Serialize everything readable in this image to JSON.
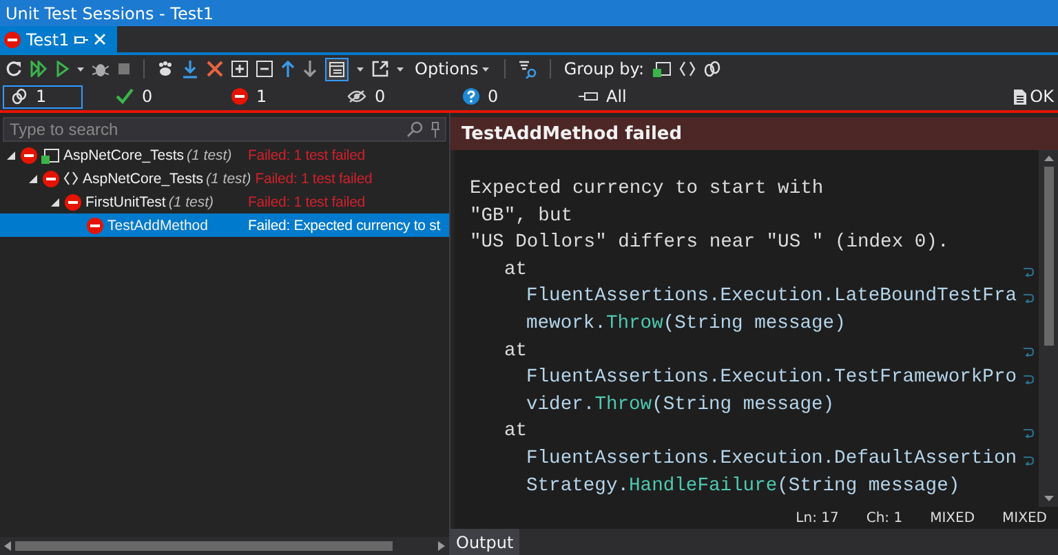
{
  "window": {
    "title": "Unit Test Sessions - Test1"
  },
  "tabs": [
    {
      "label": "Test1",
      "selected": true
    }
  ],
  "toolbar": {
    "options_label": "Options",
    "group_by_label": "Group by:"
  },
  "filters": [
    {
      "kind": "session",
      "count": "1",
      "selected": true
    },
    {
      "kind": "passed",
      "count": "0",
      "selected": false
    },
    {
      "kind": "failed",
      "count": "1",
      "selected": false
    },
    {
      "kind": "ignored",
      "count": "0",
      "selected": false
    },
    {
      "kind": "unknown",
      "count": "0",
      "selected": false
    },
    {
      "kind": "all",
      "label": "All",
      "selected": false
    }
  ],
  "result_badge": "OK",
  "search": {
    "placeholder": "Type to search"
  },
  "tree": [
    {
      "kind": "project",
      "name": "AspNetCore_Tests",
      "count": "(1 test)",
      "status": "Failed: 1 test failed",
      "expanded": true,
      "selected": false,
      "children": [
        {
          "kind": "namespace",
          "name": "AspNetCore_Tests",
          "count": "(1 test)",
          "status": "Failed: 1 test failed",
          "expanded": true,
          "selected": false,
          "children": [
            {
              "name": "FirstUnitTest",
              "count": "(1 test)",
              "status": "Failed: 1 test failed",
              "expanded": true,
              "selected": false,
              "children": [
                {
                  "name": "TestAddMethod",
                  "status": "Failed: Expected currency to st",
                  "selected": true
                }
              ]
            }
          ]
        }
      ]
    }
  ],
  "details": {
    "title": "TestAddMethod failed",
    "lines": [
      {
        "kind": "message",
        "wrapped": false,
        "segments": [
          {
            "text": "Expected currency to start with"
          }
        ]
      },
      {
        "kind": "message",
        "wrapped": false,
        "segments": [
          {
            "text": "\"GB\", but"
          }
        ]
      },
      {
        "kind": "message",
        "wrapped": false,
        "segments": [
          {
            "text": "\"US Dollors\" differs near \"US \" (index 0)."
          }
        ]
      },
      {
        "kind": "at",
        "wrapped": true,
        "segments": [
          {
            "text": "at"
          }
        ]
      },
      {
        "kind": "frame",
        "wrapped": true,
        "segments": [
          {
            "text": "FluentAssertions.Execution.LateBoundTestFra"
          }
        ]
      },
      {
        "kind": "frame",
        "wrapped": false,
        "segments": [
          {
            "text": "mework."
          },
          {
            "text": "Throw",
            "kind": "method"
          },
          {
            "text": "(String message)"
          }
        ]
      },
      {
        "kind": "at",
        "wrapped": true,
        "segments": [
          {
            "text": "at"
          }
        ]
      },
      {
        "kind": "frame",
        "wrapped": true,
        "segments": [
          {
            "text": "FluentAssertions.Execution.TestFrameworkPro"
          }
        ]
      },
      {
        "kind": "frame",
        "wrapped": false,
        "segments": [
          {
            "text": "vider."
          },
          {
            "text": "Throw",
            "kind": "method"
          },
          {
            "text": "(String message)"
          }
        ]
      },
      {
        "kind": "at",
        "wrapped": true,
        "segments": [
          {
            "text": "at"
          }
        ]
      },
      {
        "kind": "frame",
        "wrapped": true,
        "segments": [
          {
            "text": "FluentAssertions.Execution.DefaultAssertion"
          }
        ]
      },
      {
        "kind": "frame",
        "wrapped": false,
        "segments": [
          {
            "text": "Strategy."
          },
          {
            "text": "HandleFailure",
            "kind": "method"
          },
          {
            "text": "(String message)"
          }
        ]
      }
    ]
  },
  "status_bar": [
    "Ln: 17",
    "Ch: 1",
    "MIXED",
    "MIXED"
  ],
  "bottom_tabs": [
    {
      "label": "Output",
      "selected": true
    }
  ]
}
